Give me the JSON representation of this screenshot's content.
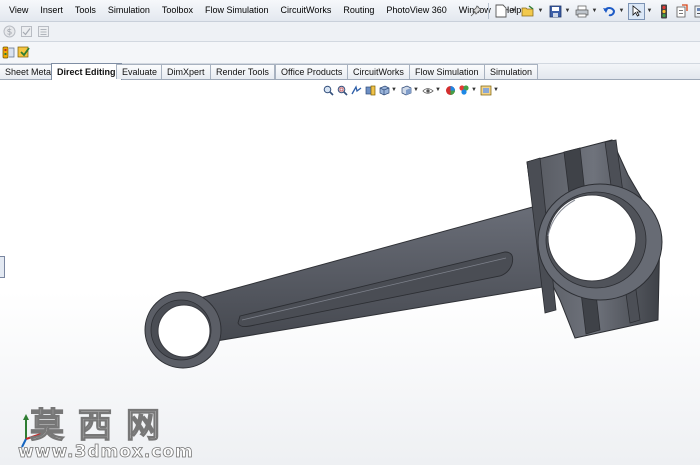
{
  "menubar": {
    "items": [
      "View",
      "Insert",
      "Tools",
      "Simulation",
      "Toolbox",
      "Flow Simulation",
      "CircuitWorks",
      "Routing",
      "PhotoView 360",
      "Window",
      "Help"
    ]
  },
  "quick_toolbar": {
    "icons": [
      "pushpin-icon",
      "new-document-icon",
      "open-folder-icon",
      "save-icon",
      "print-icon",
      "undo-icon",
      "select-pointer-icon",
      "rebuild-traffic-light-icon",
      "file-properties-icon",
      "options-icon"
    ]
  },
  "command_manager": {
    "tabs": [
      {
        "label": "Sheet Metal"
      },
      {
        "label": "Direct Editing"
      },
      {
        "label": "Evaluate"
      },
      {
        "label": "DimXpert"
      },
      {
        "label": "Render Tools"
      },
      {
        "label": "Office Products"
      },
      {
        "label": "CircuitWorks"
      },
      {
        "label": "Flow Simulation"
      },
      {
        "label": "Simulation"
      }
    ],
    "active_tab": "Direct Editing"
  },
  "heads_up_toolbar": {
    "icons": [
      "zoom-to-fit-icon",
      "zoom-area-icon",
      "previous-view-icon",
      "section-view-icon",
      "view-orientation-icon",
      "display-style-icon",
      "hide-show-items-icon",
      "edit-appearance-icon",
      "apply-scene-icon",
      "view-settings-icon"
    ]
  },
  "watermark": {
    "chinese": "莫西网",
    "url": "www.3dmox.com"
  },
  "colors": {
    "part_fill": "#5a5d66",
    "part_dark": "#3b3e45",
    "part_light": "#8a8e98"
  }
}
